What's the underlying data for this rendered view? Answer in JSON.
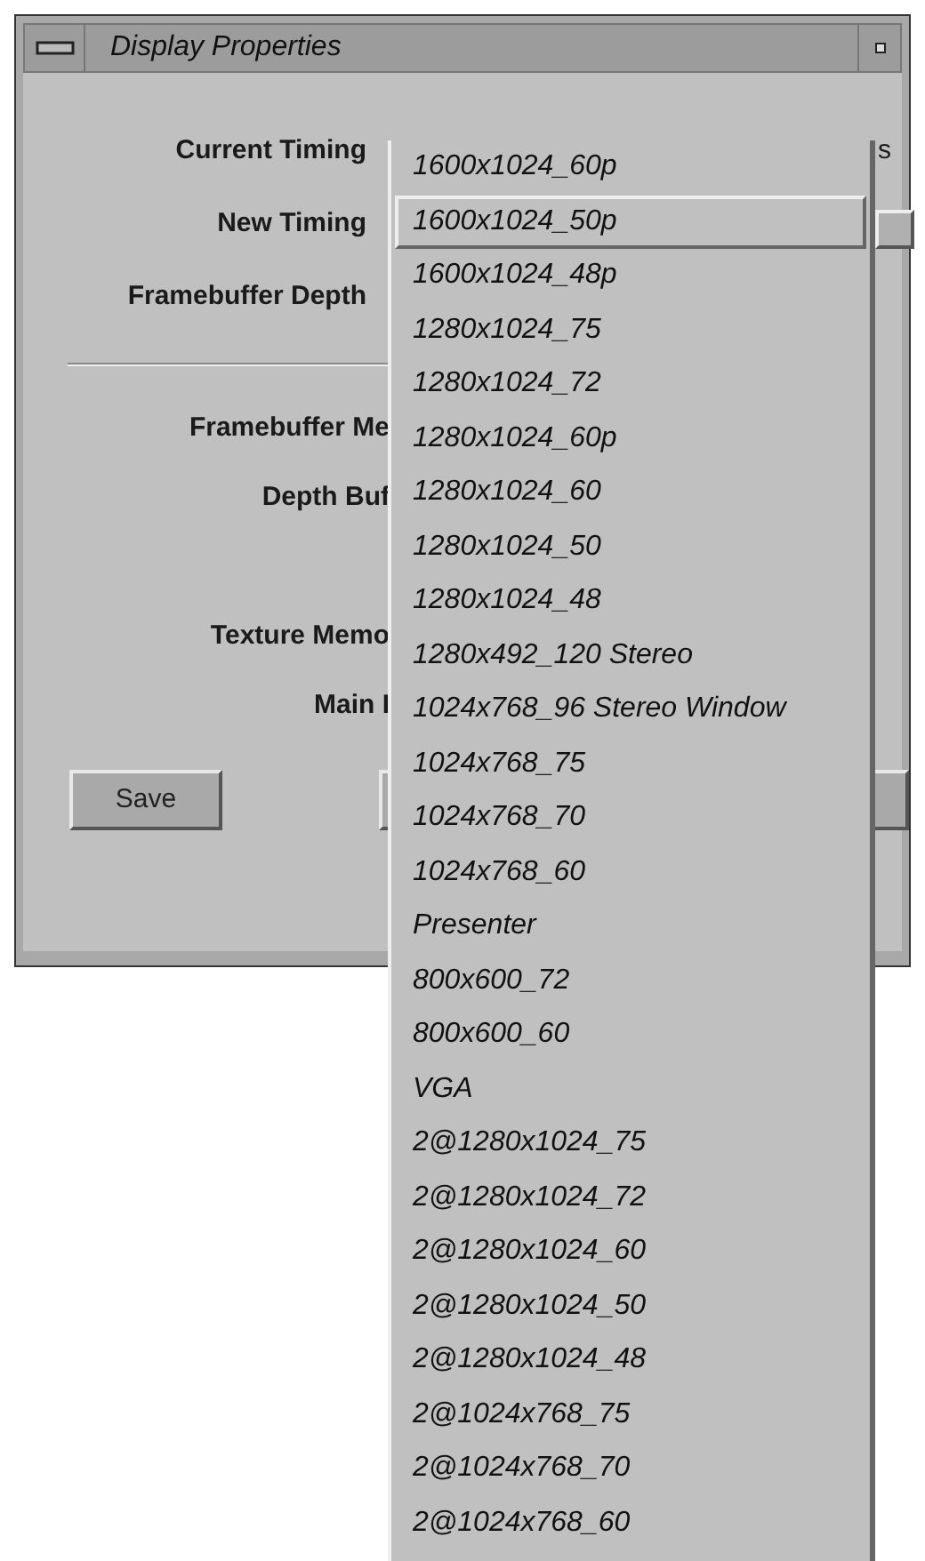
{
  "window": {
    "title": "Display Properties"
  },
  "fields": [
    {
      "label": "Current Timing",
      "value": "s"
    },
    {
      "label": "New Timing"
    },
    {
      "label": "Framebuffer Depth"
    }
  ],
  "memory_groups": [
    {
      "labels": [
        "Framebuffer Me",
        "Depth Buf"
      ]
    },
    {
      "labels": [
        "Texture Memo",
        "Main I"
      ]
    }
  ],
  "buttons": [
    {
      "kind": "labeled",
      "label": "Save"
    },
    {
      "kind": "covered"
    },
    {
      "kind": "covered"
    }
  ],
  "timing_menu": {
    "items": [
      {
        "label": "1600x1024_60p",
        "selected": false
      },
      {
        "label": "1600x1024_50p",
        "selected": true
      },
      {
        "label": "1600x1024_48p",
        "selected": false
      },
      {
        "label": "1280x1024_75",
        "selected": false
      },
      {
        "label": "1280x1024_72",
        "selected": false
      },
      {
        "label": "1280x1024_60p",
        "selected": false
      },
      {
        "label": "1280x1024_60",
        "selected": false
      },
      {
        "label": "1280x1024_50",
        "selected": false
      },
      {
        "label": "1280x1024_48",
        "selected": false
      },
      {
        "label": "1280x492_120 Stereo",
        "selected": false
      },
      {
        "label": "1024x768_96 Stereo Window",
        "selected": false
      },
      {
        "label": "1024x768_75",
        "selected": false
      },
      {
        "label": "1024x768_70",
        "selected": false
      },
      {
        "label": "1024x768_60",
        "selected": false
      },
      {
        "label": "Presenter",
        "selected": false
      },
      {
        "label": "800x600_72",
        "selected": false
      },
      {
        "label": "800x600_60",
        "selected": false
      },
      {
        "label": "VGA",
        "selected": false
      },
      {
        "label": "2@1280x1024_75",
        "selected": false
      },
      {
        "label": "2@1280x1024_72",
        "selected": false
      },
      {
        "label": "2@1280x1024_60",
        "selected": false
      },
      {
        "label": "2@1280x1024_50",
        "selected": false
      },
      {
        "label": "2@1280x1024_48",
        "selected": false
      },
      {
        "label": "2@1024x768_75",
        "selected": false
      },
      {
        "label": "2@1024x768_70",
        "selected": false
      },
      {
        "label": "2@1024x768_60",
        "selected": false
      }
    ]
  }
}
